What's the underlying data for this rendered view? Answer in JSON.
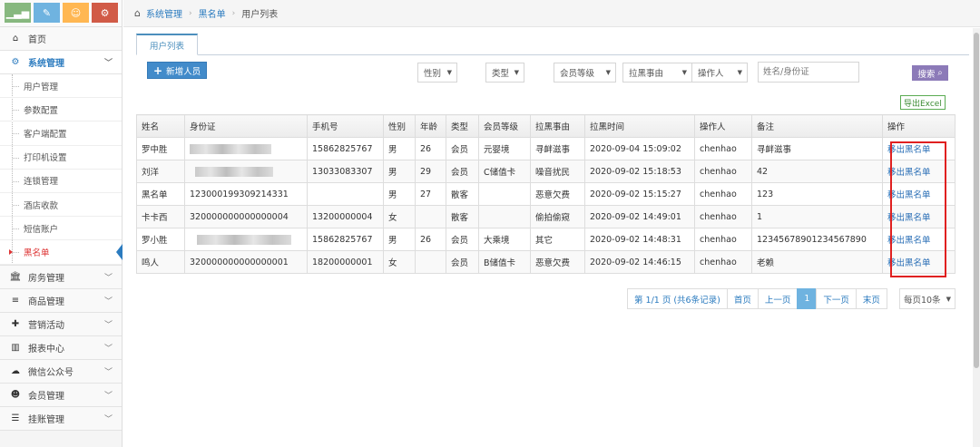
{
  "colors": {
    "shortcut_1": "#87b87f",
    "shortcut_2": "#6fb3e0",
    "shortcut_3": "#ffb752",
    "shortcut_4": "#d15b47",
    "accent": "#2b7bbf",
    "highlight_box": "#e02020"
  },
  "shortcuts": [
    {
      "icon": "signal-icon",
      "glyph": "▁▃▅"
    },
    {
      "icon": "pencil-icon",
      "glyph": "✎"
    },
    {
      "icon": "users-icon",
      "glyph": "☺"
    },
    {
      "icon": "cogs-icon",
      "glyph": "⚙"
    }
  ],
  "sidebar": {
    "home": {
      "label": "首页",
      "icon": "home-icon",
      "glyph": "⌂"
    },
    "system": {
      "label": "系统管理",
      "icon": "gear-icon",
      "glyph": "⚙"
    },
    "sub_items": [
      {
        "label": "用户管理"
      },
      {
        "label": "参数配置"
      },
      {
        "label": "客户端配置"
      },
      {
        "label": "打印机设置"
      },
      {
        "label": "连锁管理"
      },
      {
        "label": "酒店收款"
      },
      {
        "label": "短信账户"
      },
      {
        "label": "黑名单"
      }
    ],
    "menus": [
      {
        "label": "房务管理",
        "icon": "bank-icon",
        "glyph": "🏛"
      },
      {
        "label": "商品管理",
        "icon": "database-icon",
        "glyph": "≡"
      },
      {
        "label": "营销活动",
        "icon": "gift-icon",
        "glyph": "✚"
      },
      {
        "label": "报表中心",
        "icon": "bar-chart-icon",
        "glyph": "▥"
      },
      {
        "label": "微信公众号",
        "icon": "cloud-icon",
        "glyph": "☁"
      },
      {
        "label": "会员管理",
        "icon": "group-icon",
        "glyph": "☻"
      },
      {
        "label": "挂账管理",
        "icon": "list-icon",
        "glyph": "☰"
      }
    ]
  },
  "breadcrumb": {
    "items": [
      "系统管理",
      "黑名单",
      "用户列表"
    ]
  },
  "tab": {
    "label": "用户列表"
  },
  "toolbar": {
    "add_label": "新增人员",
    "filters": [
      "性别",
      "类型",
      "会员等级",
      "拉黑事由",
      "操作人"
    ],
    "search_placeholder": "姓名/身份证",
    "search_label": "搜索",
    "export_label": "导出Excel"
  },
  "table": {
    "headers": [
      "姓名",
      "身份证",
      "手机号",
      "性别",
      "年龄",
      "类型",
      "会员等级",
      "拉黑事由",
      "拉黑时间",
      "操作人",
      "备注",
      "操作"
    ],
    "rows": [
      {
        "name": "罗中胜",
        "id": "",
        "phone": "15862825767",
        "gender": "男",
        "age": "26",
        "type": "会员",
        "level": "元婴境",
        "reason": "寻衅滋事",
        "time": "2020-09-04 15:09:02",
        "operator": "chenhao",
        "note": "寻衅滋事",
        "action": "移出黑名单"
      },
      {
        "name": "刘洋",
        "id": "",
        "phone": "13033083307",
        "gender": "男",
        "age": "29",
        "type": "会员",
        "level": "C储值卡",
        "reason": "噪音扰民",
        "time": "2020-09-02 15:18:53",
        "operator": "chenhao",
        "note": "42",
        "action": "移出黑名单"
      },
      {
        "name": "黑名单",
        "id": "123000199309214331",
        "phone": "",
        "gender": "男",
        "age": "27",
        "type": "散客",
        "level": "",
        "reason": "恶意欠费",
        "time": "2020-09-02 15:15:27",
        "operator": "chenhao",
        "note": "123",
        "action": "移出黑名单"
      },
      {
        "name": "卡卡西",
        "id": "320000000000000004",
        "phone": "13200000004",
        "gender": "女",
        "age": "",
        "type": "散客",
        "level": "",
        "reason": "偷拍偷窥",
        "time": "2020-09-02 14:49:01",
        "operator": "chenhao",
        "note": "1",
        "action": "移出黑名单"
      },
      {
        "name": "罗小胜",
        "id": "",
        "phone": "15862825767",
        "gender": "男",
        "age": "26",
        "type": "会员",
        "level": "大乘境",
        "reason": "其它",
        "time": "2020-09-02 14:48:31",
        "operator": "chenhao",
        "note": "12345678901234567890",
        "action": "移出黑名单"
      },
      {
        "name": "鸣人",
        "id": "320000000000000001",
        "phone": "18200000001",
        "gender": "女",
        "age": "",
        "type": "会员",
        "level": "B储值卡",
        "reason": "恶意欠费",
        "time": "2020-09-02 14:46:15",
        "operator": "chenhao",
        "note": "老赖",
        "action": "移出黑名单"
      }
    ]
  },
  "pagination": {
    "info": "第 1/1 页 (共6条记录)",
    "first": "首页",
    "prev": "上一页",
    "current": "1",
    "next": "下一页",
    "last": "末页",
    "page_size": "每页10条"
  }
}
